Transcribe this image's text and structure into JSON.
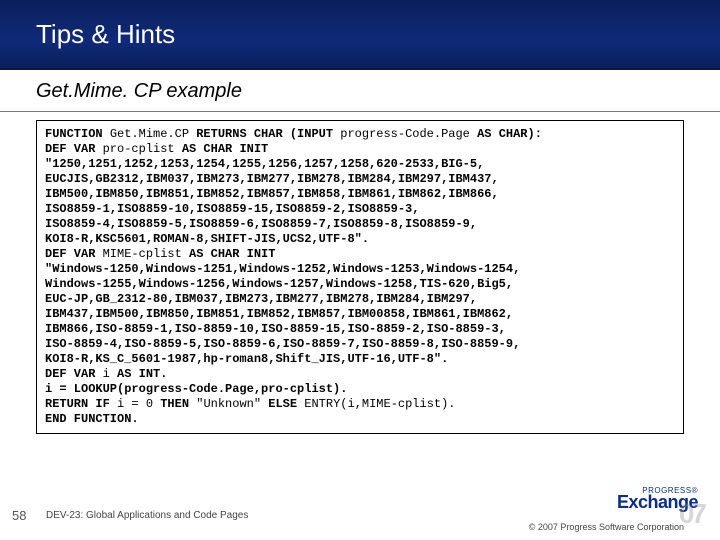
{
  "header": {
    "title": "Tips & Hints"
  },
  "subtitle": "Get.Mime. CP example",
  "code": {
    "l1_a": "FUNCTION ",
    "l1_b": "Get.Mime.CP ",
    "l1_c": "RETURNS CHAR (INPUT ",
    "l1_d": "progress-Code.Page ",
    "l1_e": "AS CHAR):",
    "l2_a": "    DEF VAR ",
    "l2_b": "pro-cplist ",
    "l2_c": "AS CHAR INIT",
    "block1": "\"1250,1251,1252,1253,1254,1255,1256,1257,1258,620-2533,BIG-5,\nEUCJIS,GB2312,IBM037,IBM273,IBM277,IBM278,IBM284,IBM297,IBM437,\nIBM500,IBM850,IBM851,IBM852,IBM857,IBM858,IBM861,IBM862,IBM866,\nISO8859-1,ISO8859-10,ISO8859-15,ISO8859-2,ISO8859-3,\nISO8859-4,ISO8859-5,ISO8859-6,ISO8859-7,ISO8859-8,ISO8859-9,\nKOI8-R,KSC5601,ROMAN-8,SHIFT-JIS,UCS2,UTF-8\".",
    "l3_a": "    DEF VAR ",
    "l3_b": "MIME-cplist ",
    "l3_c": "AS CHAR INIT",
    "block2": "\"Windows-1250,Windows-1251,Windows-1252,Windows-1253,Windows-1254,\nWindows-1255,Windows-1256,Windows-1257,Windows-1258,TIS-620,Big5,\nEUC-JP,GB_2312-80,IBM037,IBM273,IBM277,IBM278,IBM284,IBM297,\nIBM437,IBM500,IBM850,IBM851,IBM852,IBM857,IBM00858,IBM861,IBM862,\nIBM866,ISO-8859-1,ISO-8859-10,ISO-8859-15,ISO-8859-2,ISO-8859-3,\nISO-8859-4,ISO-8859-5,ISO-8859-6,ISO-8859-7,ISO-8859-8,ISO-8859-9,\nKOI8-R,KS_C_5601-1987,hp-roman8,Shift_JIS,UTF-16,UTF-8\".",
    "l4_a": "    DEF VAR ",
    "l4_b": "i ",
    "l4_c": "AS INT.",
    "l5": "    i = LOOKUP(progress-Code.Page,pro-cplist).",
    "l6_a": "    RETURN IF ",
    "l6_b": "i = 0 ",
    "l6_c": "THEN ",
    "l6_d": "\"Unknown\" ",
    "l6_e": "ELSE ",
    "l6_f": "ENTRY(i,MIME-cplist).",
    "l7": "END FUNCTION."
  },
  "footer": {
    "page": "58",
    "title": "DEV-23: Global Applications and Code Pages",
    "copyright": "© 2007 Progress Software Corporation"
  },
  "logo": {
    "small": "PROGRESS®",
    "big": "Exchange",
    "year": "07"
  }
}
